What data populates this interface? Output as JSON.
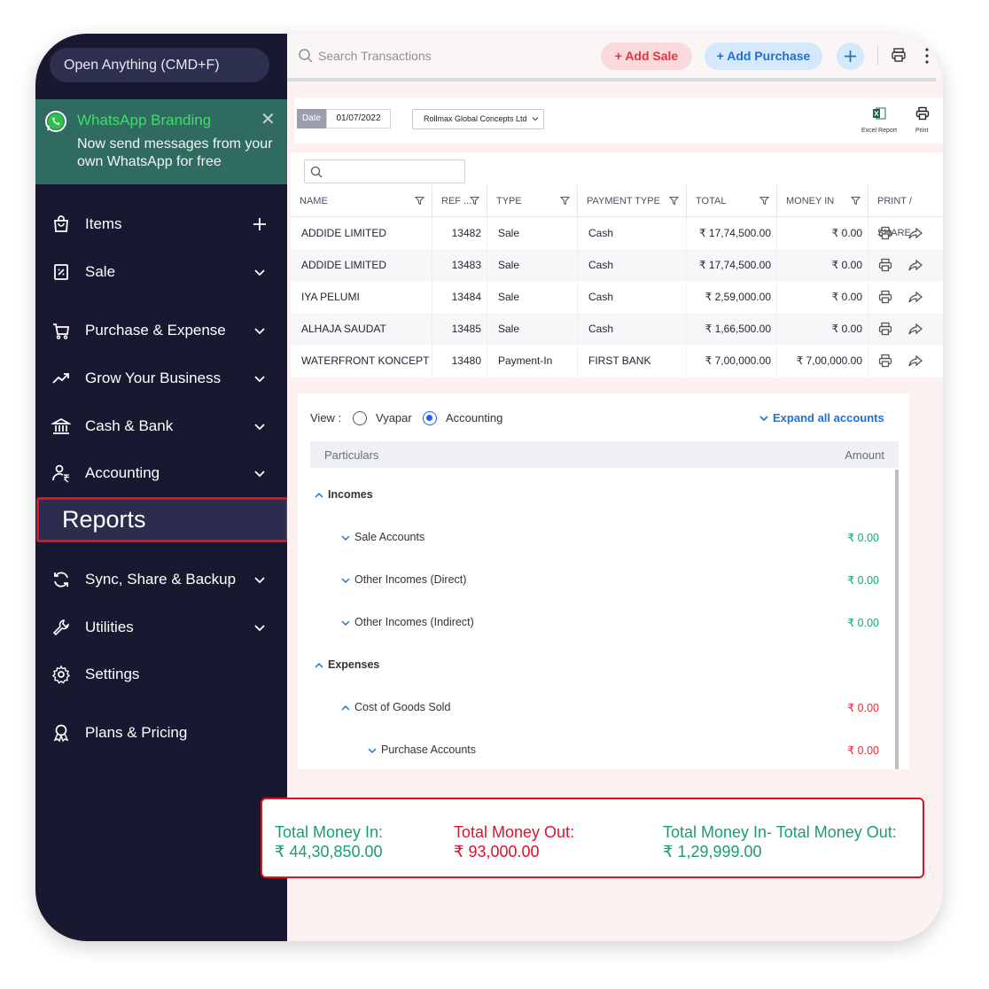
{
  "sidebar": {
    "open_anything": "Open Anything (CMD+F)",
    "whatsapp": {
      "title": "WhatsApp Branding",
      "text": "Now send messages from your own WhatsApp for free"
    },
    "items": [
      {
        "label": "Items",
        "icon": "shopping-bag-icon",
        "right": "plus-icon"
      },
      {
        "label": "Sale",
        "icon": "receipt-icon",
        "right": "chevron-down-icon"
      },
      {
        "label": "Purchase & Expense",
        "icon": "cart-icon",
        "right": "chevron-down-icon"
      },
      {
        "label": "Grow Your Business",
        "icon": "trending-up-icon",
        "right": "chevron-down-icon"
      },
      {
        "label": "Cash & Bank",
        "icon": "bank-icon",
        "right": "chevron-down-icon"
      },
      {
        "label": "Accounting",
        "icon": "user-rupee-icon",
        "right": "chevron-down-icon"
      },
      {
        "label": "Reports",
        "icon": "",
        "right": ""
      },
      {
        "label": "Sync, Share & Backup",
        "icon": "sync-icon",
        "right": "chevron-down-icon"
      },
      {
        "label": "Utilities",
        "icon": "wrench-icon",
        "right": "chevron-down-icon"
      },
      {
        "label": "Settings",
        "icon": "gear-icon",
        "right": ""
      },
      {
        "label": "Plans & Pricing",
        "icon": "badge-icon",
        "right": ""
      }
    ]
  },
  "topbar": {
    "search_placeholder": "Search Transactions",
    "add_sale": "Add Sale",
    "add_purchase": "Add Purchase"
  },
  "filter": {
    "date_tag": "Date",
    "date_value": "01/07/2022",
    "firm": "Rollmax Global Concepts Ltd",
    "excel_report": "Excel Report",
    "print": "Print"
  },
  "table": {
    "columns": [
      "NAME",
      "REF ...",
      "TYPE",
      "PAYMENT TYPE",
      "TOTAL",
      "MONEY IN",
      "PRINT / SHARE"
    ],
    "rows": [
      {
        "name": "ADDIDE LIMITED",
        "ref": "13482",
        "type": "Sale",
        "payment": "Cash",
        "total": "₹ 17,74,500.00",
        "money_in": "₹ 0.00"
      },
      {
        "name": "ADDIDE LIMITED",
        "ref": "13483",
        "type": "Sale",
        "payment": "Cash",
        "total": "₹ 17,74,500.00",
        "money_in": "₹ 0.00"
      },
      {
        "name": "IYA PELUMI",
        "ref": "13484",
        "type": "Sale",
        "payment": "Cash",
        "total": "₹ 2,59,000.00",
        "money_in": "₹ 0.00"
      },
      {
        "name": "ALHAJA SAUDAT",
        "ref": "13485",
        "type": "Sale",
        "payment": "Cash",
        "total": "₹ 1,66,500.00",
        "money_in": "₹ 0.00"
      },
      {
        "name": "WATERFRONT KONCEPT",
        "ref": "13480",
        "type": "Payment-In",
        "payment": "FIRST BANK",
        "total": "₹ 7,00,000.00",
        "money_in": "₹ 7,00,000.00"
      }
    ]
  },
  "accounts": {
    "view_label": "View :",
    "option_vyapar": "Vyapar",
    "option_accounting": "Accounting",
    "selected": "Accounting",
    "expand_all": "Expand all accounts",
    "col_particulars": "Particulars",
    "col_amount": "Amount",
    "rows": [
      {
        "label": "Incomes",
        "amount": "",
        "level": 0,
        "expanded": true
      },
      {
        "label": "Sale Accounts",
        "amount": "₹ 0.00",
        "level": 1,
        "expanded": false,
        "color": "green"
      },
      {
        "label": "Other Incomes (Direct)",
        "amount": "₹ 0.00",
        "level": 1,
        "expanded": false,
        "color": "green"
      },
      {
        "label": "Other Incomes (Indirect)",
        "amount": "₹ 0.00",
        "level": 1,
        "expanded": false,
        "color": "green"
      },
      {
        "label": "Expenses",
        "amount": "",
        "level": 0,
        "expanded": true
      },
      {
        "label": "Cost of Goods Sold",
        "amount": "₹ 0.00",
        "level": 1,
        "expanded": true,
        "color": "red"
      },
      {
        "label": "Purchase Accounts",
        "amount": "₹ 0.00",
        "level": 2,
        "expanded": false,
        "color": "red"
      }
    ]
  },
  "totals": {
    "money_in_label": "Total Money In:",
    "money_in_value": "₹ 44,30,850.00",
    "money_out_label": "Total Money Out:",
    "money_out_value": "₹ 93,000.00",
    "net_label": "Total Money In- Total Money Out:",
    "net_value": "₹ 1,29,999.00"
  },
  "colors": {
    "sidebar_bg": "#181830",
    "accent_red": "#e3101d",
    "green": "#17a56b",
    "blue": "#1f6fd6",
    "whatsapp_bg": "#2f6b61"
  }
}
